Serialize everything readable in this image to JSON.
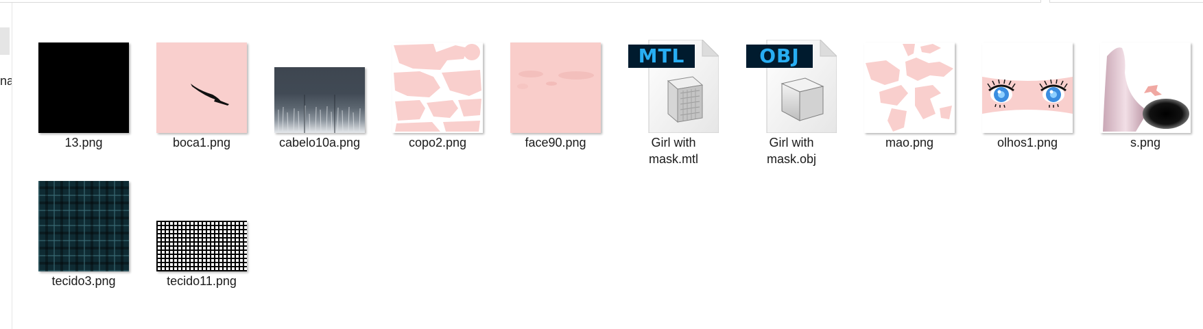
{
  "navigation_pane": {
    "partial_label": "na"
  },
  "files": [
    {
      "name": "13.png"
    },
    {
      "name": "boca1.png"
    },
    {
      "name": "cabelo10a.png"
    },
    {
      "name": "copo2.png"
    },
    {
      "name": "face90.png"
    },
    {
      "name": "Girl with mask.mtl",
      "badge": "MTL"
    },
    {
      "name": "Girl with mask.obj",
      "badge": "OBJ"
    },
    {
      "name": "mao.png"
    },
    {
      "name": "olhos1.png"
    },
    {
      "name": "s.png"
    },
    {
      "name": "tecido3.png"
    },
    {
      "name": "tecido11.png"
    }
  ]
}
